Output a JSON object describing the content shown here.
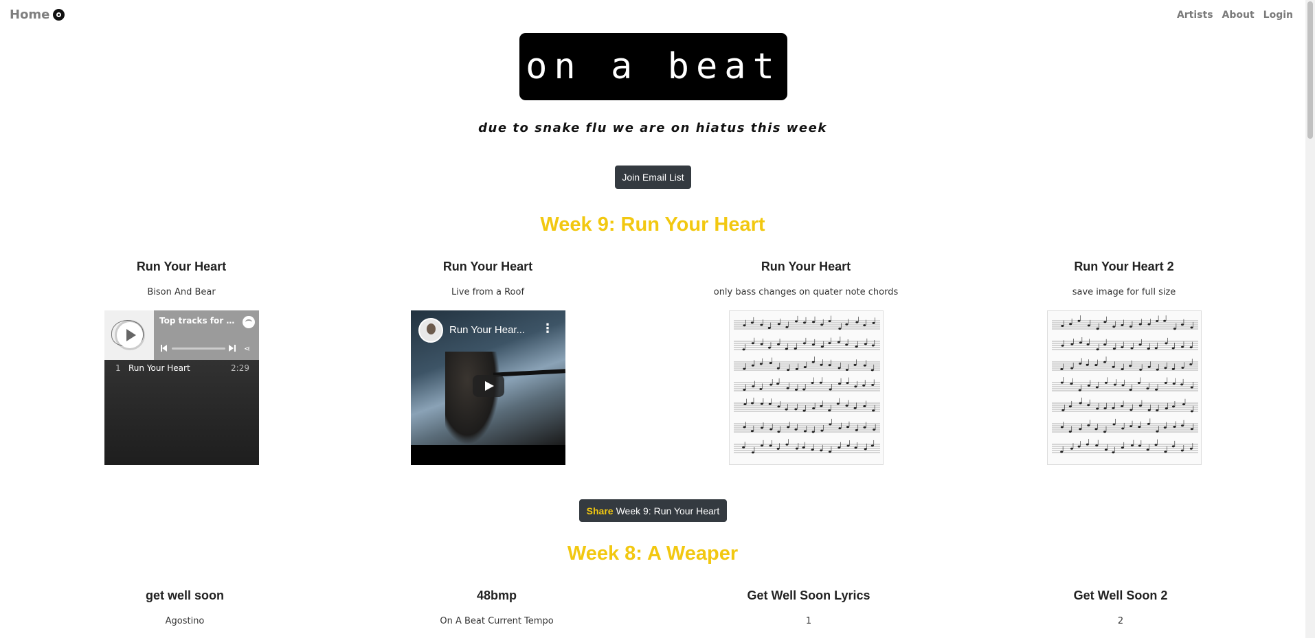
{
  "nav": {
    "home_label": "Home",
    "home_icon": "vinyl-record-icon",
    "links": [
      "Artists",
      "About",
      "Login"
    ]
  },
  "logo": {
    "text": "on a beat"
  },
  "tagline": "due to snake flu we are on hiatus this week",
  "join_button": "Join Email List",
  "colors": {
    "accent": "#f2c811",
    "button": "#343a40"
  },
  "week9": {
    "title": "Week 9: Run Your Heart",
    "cards": [
      {
        "title": "Run Your Heart",
        "subtitle": "Bison And Bear",
        "media": "spotify-embed"
      },
      {
        "title": "Run Your Heart",
        "subtitle": "Live from a Roof",
        "media": "youtube-embed"
      },
      {
        "title": "Run Your Heart",
        "subtitle": "only bass changes on quater note chords",
        "media": "sheet-music-image"
      },
      {
        "title": "Run Your Heart 2",
        "subtitle": "save image for full size",
        "media": "sheet-music-image"
      }
    ],
    "spotify": {
      "header": "Top tracks for Bi...",
      "track_number": "1",
      "track_name": "Run Your Heart",
      "track_duration": "2:29"
    },
    "youtube": {
      "title": "Run Your Hear..."
    },
    "share": {
      "label_highlight": "Share",
      "label": "Week 9: Run Your Heart"
    }
  },
  "week8": {
    "title": "Week 8: A Weaper",
    "cards": [
      {
        "title": "get well soon",
        "subtitle": "Agostino"
      },
      {
        "title": "48bmp",
        "subtitle": "On A Beat Current Tempo"
      },
      {
        "title": "Get Well Soon Lyrics",
        "subtitle": "1"
      },
      {
        "title": "Get Well Soon 2",
        "subtitle": "2"
      }
    ]
  }
}
